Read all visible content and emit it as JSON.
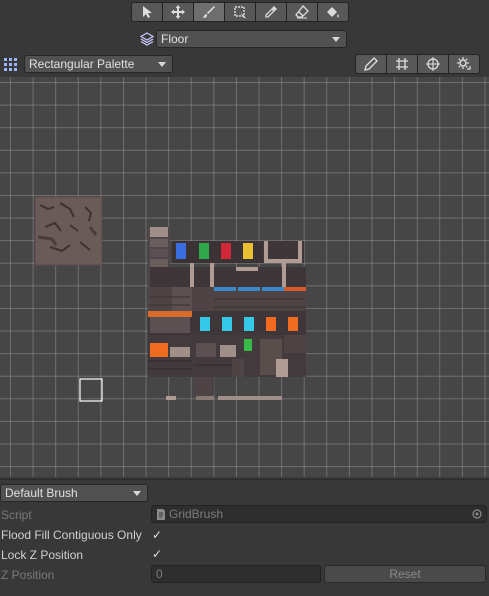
{
  "toolbar": {
    "tools": [
      {
        "name": "select-icon"
      },
      {
        "name": "move-icon"
      },
      {
        "name": "paint-brush-icon",
        "active": true
      },
      {
        "name": "box-fill-icon"
      },
      {
        "name": "picker-icon"
      },
      {
        "name": "eraser-icon"
      },
      {
        "name": "flood-fill-icon"
      }
    ]
  },
  "layer": {
    "value": "Floor",
    "icon": "layers-icon"
  },
  "palette": {
    "value": "Rectangular Palette",
    "icon": "palette-grid-icon"
  },
  "view_buttons": [
    "edit-pencil-icon",
    "grid-icon",
    "gizmo-icon",
    "settings-icon"
  ],
  "brush": {
    "value": "Default Brush"
  },
  "inspector": {
    "script_label": "Script",
    "script_value": "GridBrush",
    "flood_label": "Flood Fill Contiguous Only",
    "flood_checked": "✓",
    "lockz_label": "Lock Z Position",
    "lockz_checked": "✓",
    "zpos_label": "Z Position",
    "zpos_value": "0",
    "reset_label": "Reset"
  },
  "colors": {
    "background": "#383838",
    "canvas": "#464646",
    "banner_blue": "#3a6ee0",
    "banner_green": "#2ea84a",
    "banner_red": "#d02838",
    "banner_yellow": "#e8c030",
    "fire_orange": "#f06a20",
    "water_cyan": "#35c8e8"
  }
}
